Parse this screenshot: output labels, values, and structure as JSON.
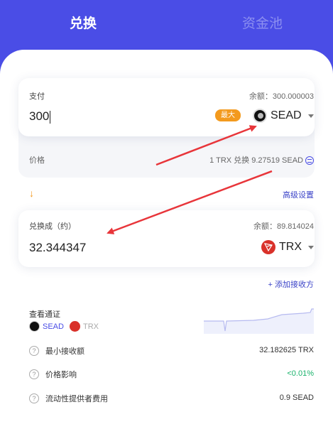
{
  "tabs": {
    "swap": "兑换",
    "pool": "资金池"
  },
  "pay": {
    "label": "支付",
    "balance": "余额：300.000003",
    "amount": "300",
    "max": "最大",
    "token": "SEAD",
    "token_icon": "sead-logo-icon"
  },
  "price": {
    "label": "价格",
    "value": "1 TRX 兑换 9.27519 SEAD"
  },
  "advanced": "高级设置",
  "receive": {
    "label": "兑换成（约）",
    "balance": "余额：89.814024",
    "amount": "32.344347",
    "token": "TRX",
    "token_icon": "tron-logo-icon"
  },
  "add_receiver": "+ 添加接收方",
  "route": {
    "label": "查看通证",
    "from": "SEAD",
    "to": "TRX"
  },
  "details": [
    {
      "label": "最小接收额",
      "value": "32.182625 TRX"
    },
    {
      "label": "价格影响",
      "value": "<0.01%"
    },
    {
      "label": "流动性提供者费用",
      "value": "0.9 SEAD"
    }
  ],
  "colors": {
    "brand": "#4a4de6",
    "accent": "#f39a1e",
    "positive": "#17b26a",
    "annotation": "#e8353a"
  }
}
